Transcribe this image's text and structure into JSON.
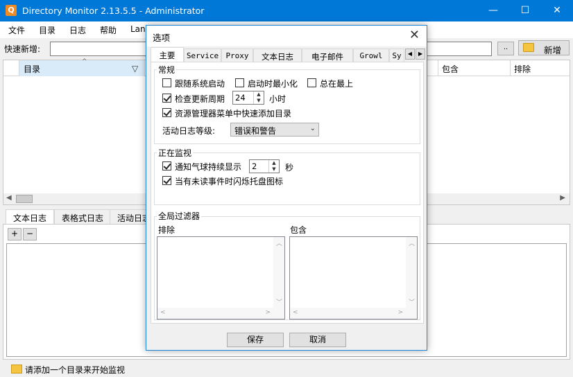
{
  "window": {
    "title": "Directory Monitor 2.13.5.5 - Administrator",
    "icon_name": "search-icon",
    "minimize": "—",
    "maximize": "☐",
    "close": "✕"
  },
  "menu": [
    "文件",
    "目录",
    "日志",
    "帮助",
    "Lang"
  ],
  "quickadd": {
    "label": "快速新增:",
    "value": "",
    "browse_label": "..",
    "new_label": "新增"
  },
  "grid": {
    "columns": [
      "目录",
      "包含",
      "排除"
    ]
  },
  "bottom_tabs": [
    "文本日志",
    "表格式日志",
    "活动日志"
  ],
  "log_buttons": [
    "+",
    "−"
  ],
  "status": {
    "text": "请添加一个目录来开始监视"
  },
  "dialog": {
    "title": "选项",
    "tabs": [
      "主要",
      "Service",
      "Proxy",
      "文本日志",
      "电子邮件",
      "Growl",
      "Sy"
    ],
    "general": {
      "title": "常规",
      "run_on_startup": {
        "label": "跟随系统启动",
        "checked": false
      },
      "start_minimized": {
        "label": "启动时最小化",
        "checked": false
      },
      "always_on_top": {
        "label": "总在最上",
        "checked": false
      },
      "check_updates": {
        "label": "检查更新周期",
        "checked": true,
        "value": "24",
        "unit": "小时"
      },
      "explorer_menu": {
        "label": "资源管理器菜单中快速添加目录",
        "checked": true
      },
      "log_level_label": "活动日志等级:",
      "log_level_value": "错误和警告"
    },
    "monitoring": {
      "title": "正在监视",
      "balloon": {
        "label": "通知气球持续显示",
        "checked": true,
        "value": "2",
        "unit": "秒"
      },
      "flash_tray": {
        "label": "当有未读事件时闪烁托盘图标",
        "checked": true
      }
    },
    "filters": {
      "title": "全局过滤器",
      "exclude_label": "排除",
      "include_label": "包含"
    },
    "save_label": "保存",
    "cancel_label": "取消"
  }
}
